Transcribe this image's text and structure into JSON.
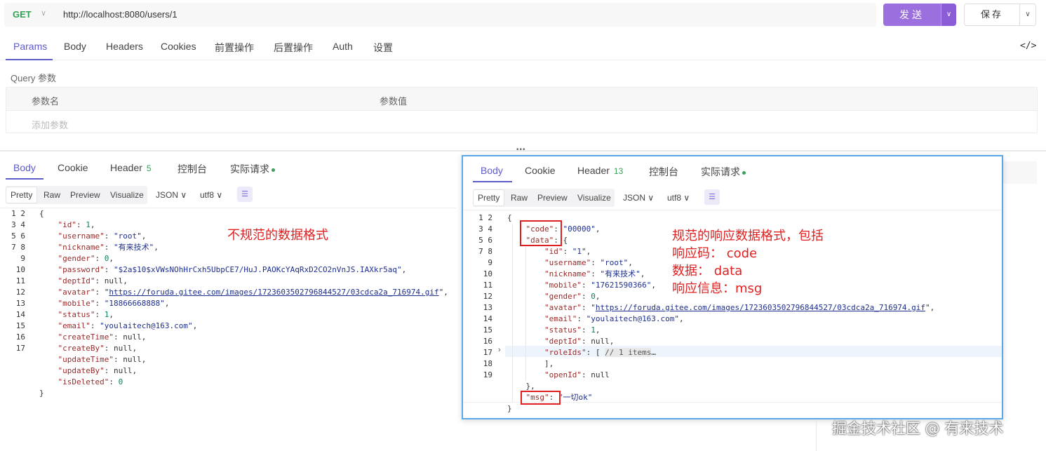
{
  "request": {
    "method": "GET",
    "url": "http://localhost:8080/users/1",
    "send_label": "发送",
    "save_label": "保存"
  },
  "request_tabs": [
    "Params",
    "Body",
    "Headers",
    "Cookies",
    "前置操作",
    "后置操作",
    "Auth",
    "设置"
  ],
  "params": {
    "section_label": "Query 参数",
    "col_name": "参数名",
    "col_value": "参数值",
    "add_placeholder": "添加参数"
  },
  "left_response": {
    "tabs": {
      "body": "Body",
      "cookie": "Cookie",
      "header": "Header",
      "header_count": "5",
      "console": "控制台",
      "actual": "实际请求"
    },
    "formats": [
      "Pretty",
      "Raw",
      "Preview",
      "Visualize"
    ],
    "type_select": "JSON",
    "encoding_select": "utf8",
    "lines": [
      "{",
      "    \"id\": 1,",
      "    \"username\": \"root\",",
      "    \"nickname\": \"有来技术\",",
      "    \"gender\": 0,",
      "    \"password\": \"$2a$10$xVWsNOhHrCxh5UbpCE7/HuJ.PAOKcYAqRxD2CO2nVnJS.IAXkr5aq\",",
      "    \"deptId\": null,",
      "    \"avatar\": \"https://foruda.gitee.com/images/1723603502796844527/03cdca2a_716974.gif\",",
      "    \"mobile\": \"18866668888\",",
      "    \"status\": 1,",
      "    \"email\": \"youlaitech@163.com\",",
      "    \"createTime\": null,",
      "    \"createBy\": null,",
      "    \"updateTime\": null,",
      "    \"updateBy\": null,",
      "    \"isDeleted\": 0",
      "}"
    ],
    "annotation": "不规范的数据格式"
  },
  "right_response": {
    "tabs": {
      "body": "Body",
      "cookie": "Cookie",
      "header": "Header",
      "header_count": "13",
      "console": "控制台",
      "actual": "实际请求"
    },
    "formats": [
      "Pretty",
      "Raw",
      "Preview",
      "Visualize"
    ],
    "type_select": "JSON",
    "encoding_select": "utf8",
    "annotation_lines": [
      "规范的响应数据格式，包括",
      "响应码： code",
      "数据： data",
      "响应信息：msg"
    ]
  },
  "watermark": "掘金技术社区 @ 有来技术"
}
